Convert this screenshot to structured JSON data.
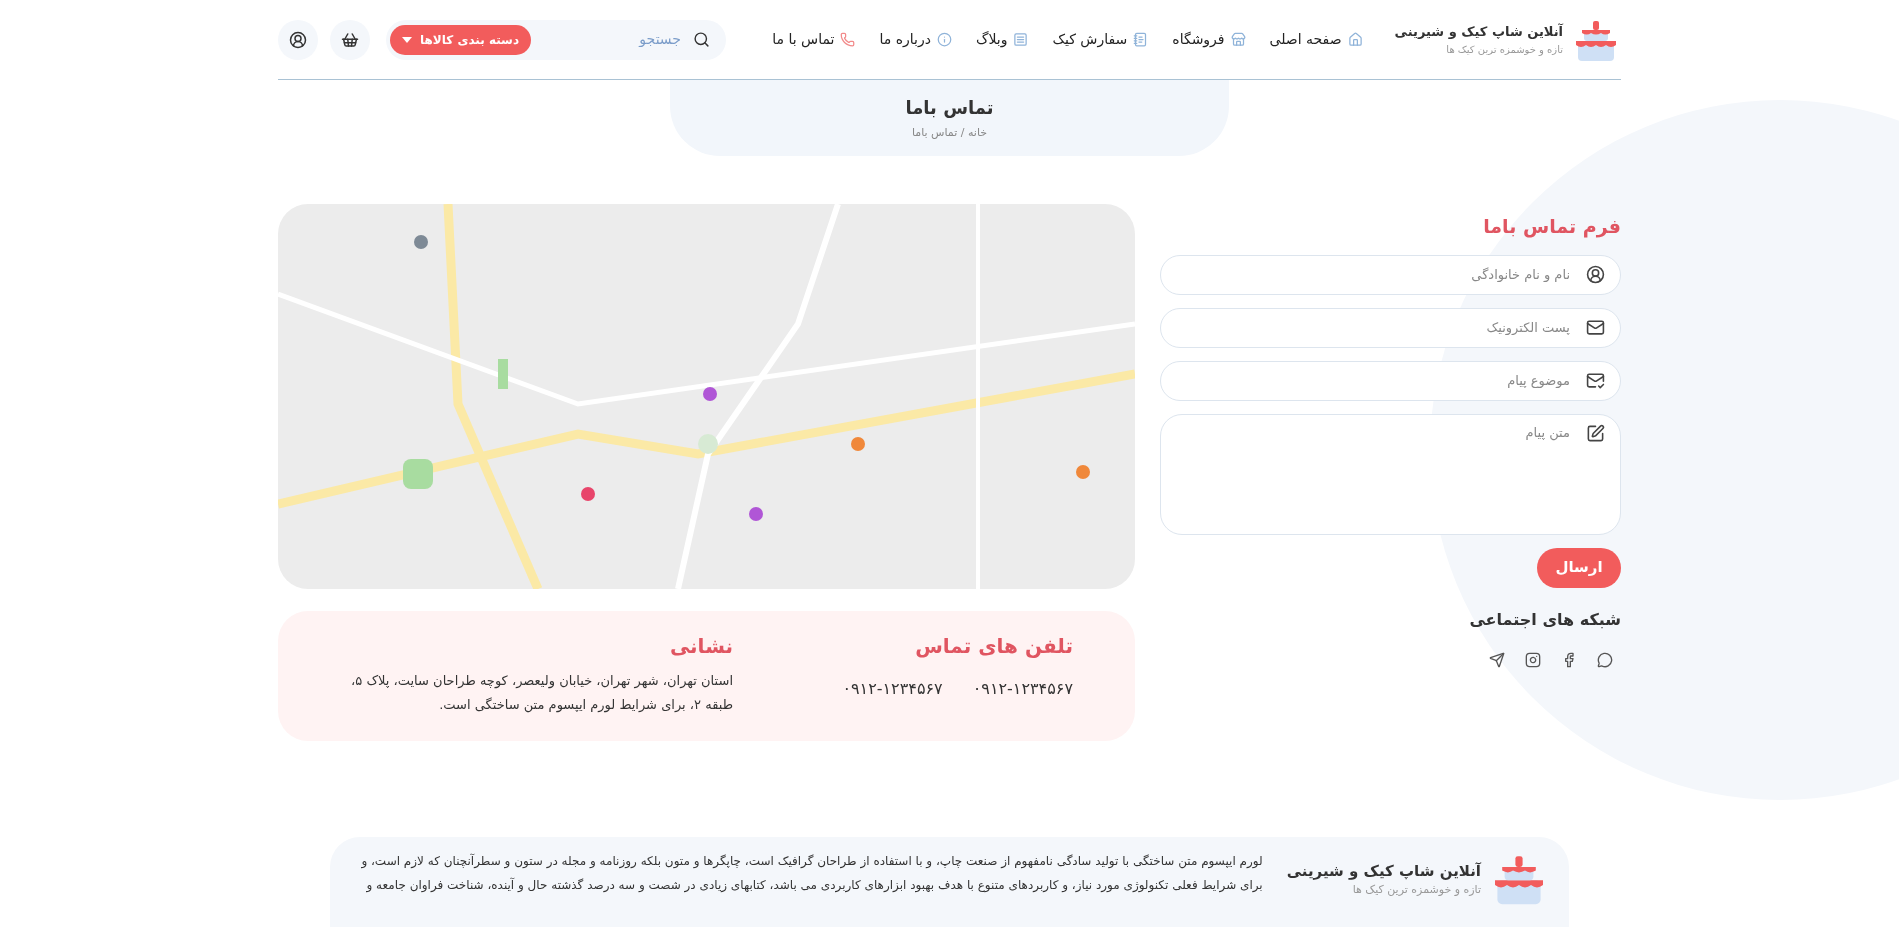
{
  "header": {
    "logo": {
      "title": "آنلاین شاپ کیک و شیرینی",
      "tagline": "تازه و خوشمزه ترین کیک ها"
    },
    "nav": [
      {
        "label": "صفحه اصلی"
      },
      {
        "label": "فروشگاه"
      },
      {
        "label": "سفارش کیک"
      },
      {
        "label": "وبلاگ"
      },
      {
        "label": "درباره ما"
      },
      {
        "label": "تماس با ما"
      }
    ],
    "search": {
      "placeholder": "جستجو"
    },
    "category_button": "دسته بندی کالاها"
  },
  "page_header": {
    "title": "تماس باما",
    "breadcrumb": "خانه / تماس باما"
  },
  "form": {
    "title": "فرم تماس باما",
    "fields": [
      {
        "kind": "input",
        "placeholder": "نام و نام خانوادگی"
      },
      {
        "kind": "input",
        "placeholder": "پست الکترونیک"
      },
      {
        "kind": "input",
        "placeholder": "موضوع پیام"
      },
      {
        "kind": "textarea",
        "placeholder": "متن پیام"
      }
    ],
    "submit": "ارسال"
  },
  "social": {
    "title": "شبکه های اجتماعی"
  },
  "contact": {
    "phones_title": "تلفن های تماس",
    "phones": [
      "۰۹۱۲-۱۲۳۴۵۶۷",
      "۰۹۱۲-۱۲۳۴۵۶۷"
    ],
    "address_title": "نشانی",
    "address": "استان تهران، شهر تهران، خیابان ولیعصر، کوچه طراحان سایت، پلاک ۵، طبقه ۲، برای شرایط لورم ایپسوم متن ساختگی است."
  },
  "footer": {
    "logo": {
      "title": "آنلاین شاپ کیک و شیرینی",
      "tagline": "تازه و خوشمزه ترین کیک ها"
    },
    "text": "لورم ایپسوم متن ساختگی با تولید سادگی نامفهوم از صنعت چاپ، و با استفاده از طراحان گرافیک است، چاپگرها و متون بلکه روزنامه و مجله در ستون و سطرآنچنان که لازم است، و برای شرایط فعلی تکنولوژی مورد نیاز، و کاربردهای متنوع با هدف بهبود ابزارهای کاربردی می باشد، کتابهای زیادی در شصت و سه درصد گذشته حال و آینده، شناخت فراوان جامعه و"
  }
}
